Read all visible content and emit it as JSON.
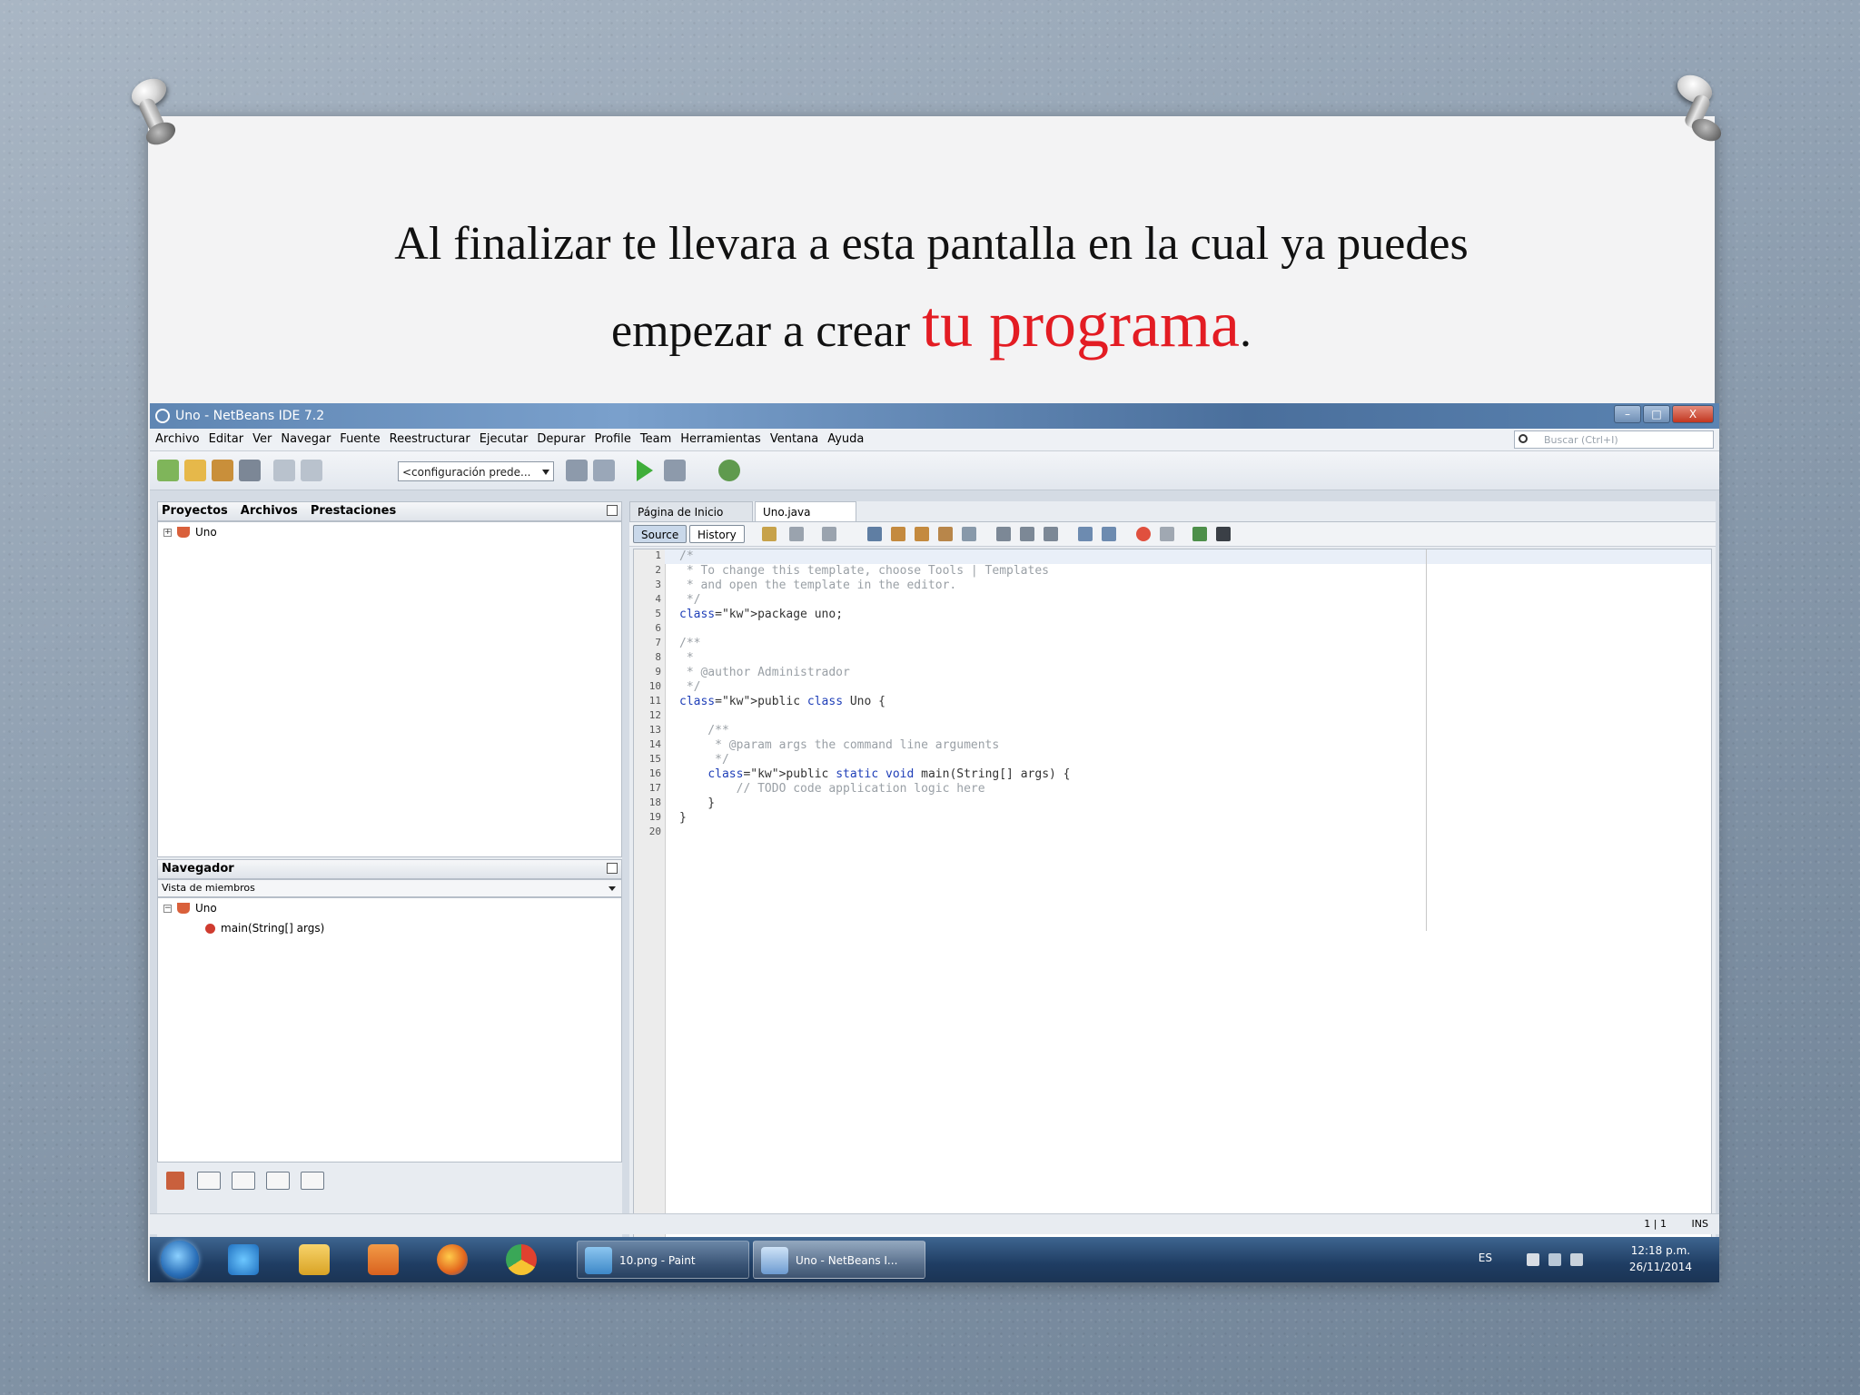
{
  "slide": {
    "heading_line1": "Al finalizar te llevara a esta pantalla en la cual ya puedes",
    "heading_line2_prefix": "empezar a crear ",
    "heading_line2_highlight": "tu programa",
    "heading_line2_suffix": "."
  },
  "ide": {
    "title": "Uno - NetBeans IDE 7.2",
    "window_buttons": [
      "–",
      "□",
      "X"
    ],
    "menu": [
      "Archivo",
      "Editar",
      "Ver",
      "Navegar",
      "Fuente",
      "Reestructurar",
      "Ejecutar",
      "Depurar",
      "Profile",
      "Team",
      "Herramientas",
      "Ventana",
      "Ayuda"
    ],
    "search_placeholder": "Buscar (Ctrl+I)",
    "config_select": "<configuración prede...",
    "projects_pane": {
      "tabs": [
        "Proyectos",
        "Archivos",
        "Prestaciones"
      ],
      "tree_root": "Uno"
    },
    "navigator_pane": {
      "title": "Navegador",
      "combo": "Vista de miembros",
      "class_node": "Uno",
      "method_node": "main(String[] args)"
    },
    "editor": {
      "tabs": [
        "Página de Inicio",
        "Uno.java"
      ],
      "source_label": "Source",
      "history_label": "History",
      "line_numbers": [
        "1",
        "2",
        "3",
        "4",
        "5",
        "6",
        "7",
        "8",
        "9",
        "10",
        "11",
        "12",
        "13",
        "14",
        "15",
        "16",
        "17",
        "18",
        "19",
        "20"
      ],
      "code_lines": [
        "/*",
        " * To change this template, choose Tools | Templates",
        " * and open the template in the editor.",
        " */",
        "package uno;",
        "",
        "/**",
        " *",
        " * @author Administrador",
        " */",
        "public class Uno {",
        "",
        "    /**",
        "     * @param args the command line arguments",
        "     */",
        "    public static void main(String[] args) {",
        "        // TODO code application logic here",
        "    }",
        "}",
        ""
      ]
    },
    "status": {
      "position": "1 | 1",
      "mode": "INS"
    }
  },
  "taskbar": {
    "tasks": [
      "10.png - Paint",
      "Uno - NetBeans I..."
    ],
    "language": "ES",
    "time": "12:18 p.m.",
    "date": "26/11/2014"
  },
  "colors": {
    "highlight_red": "#e31c23",
    "keyword_blue": "#1f3fb8",
    "comment_gray": "#9aa0a6"
  }
}
